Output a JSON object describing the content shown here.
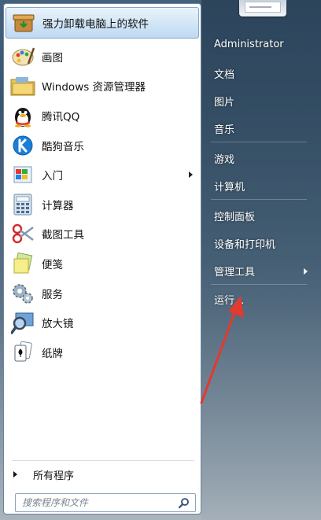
{
  "programs": [
    {
      "label": "强力卸载电脑上的软件",
      "icon": "uninstall-box-icon",
      "highlighted": true
    },
    {
      "label": "画图",
      "icon": "paint-palette-icon"
    },
    {
      "label": "Windows 资源管理器",
      "icon": "folder-explorer-icon"
    },
    {
      "label": "腾讯QQ",
      "icon": "qq-penguin-icon"
    },
    {
      "label": "酷狗音乐",
      "icon": "kugou-k-icon"
    },
    {
      "label": "入门",
      "icon": "getting-started-icon",
      "submenu": true
    },
    {
      "label": "计算器",
      "icon": "calculator-icon"
    },
    {
      "label": "截图工具",
      "icon": "scissors-icon"
    },
    {
      "label": "便笺",
      "icon": "sticky-note-icon"
    },
    {
      "label": "服务",
      "icon": "gears-icon"
    },
    {
      "label": "放大镜",
      "icon": "magnifier-icon"
    },
    {
      "label": "纸牌",
      "icon": "solitaire-cards-icon"
    }
  ],
  "all_programs_label": "所有程序",
  "search": {
    "placeholder": "搜索程序和文件"
  },
  "right_items": [
    {
      "label": "Administrator"
    },
    {
      "label": "文档"
    },
    {
      "label": "图片"
    },
    {
      "label": "音乐"
    },
    {
      "label": "游戏"
    },
    {
      "label": "计算机"
    },
    {
      "label": "控制面板"
    },
    {
      "label": "设备和打印机"
    },
    {
      "label": "管理工具",
      "submenu": true
    },
    {
      "label": "运行..."
    }
  ],
  "colors": {
    "annotation_arrow": "#e23a2e",
    "highlight": "#cfe3f5"
  }
}
